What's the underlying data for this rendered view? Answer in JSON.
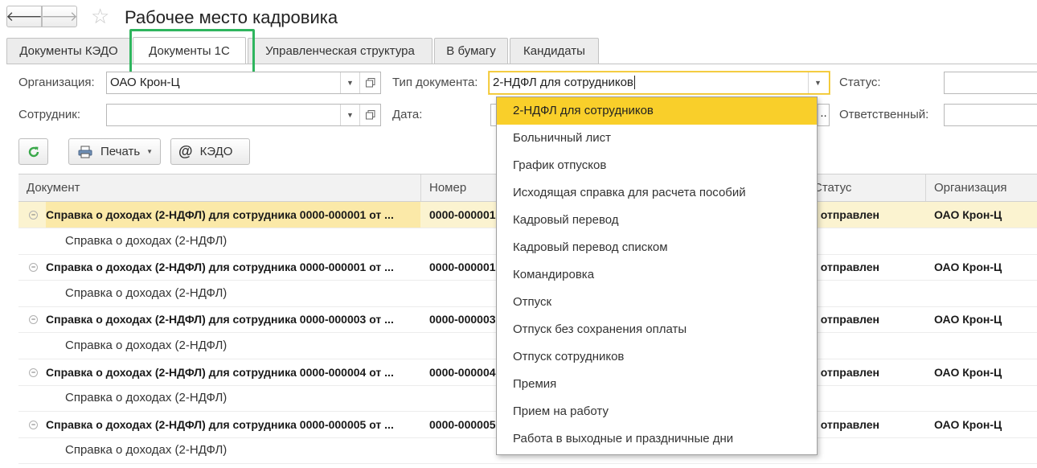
{
  "window": {
    "title": "Рабочее место кадровика",
    "back_glyph": "🡐",
    "forward_glyph": "🡒",
    "star_glyph": "☆"
  },
  "tabs": [
    {
      "label": "Документы КЭДО",
      "active": false
    },
    {
      "label": "Документы 1С",
      "active": true
    },
    {
      "label": "Управленческая структура",
      "active": false
    },
    {
      "label": "В бумагу",
      "active": false
    },
    {
      "label": "Кандидаты",
      "active": false
    }
  ],
  "filters": {
    "organization_label": "Организация:",
    "organization_value": "ОАО Крон-Ц",
    "employee_label": "Сотрудник:",
    "employee_value": "",
    "doc_type_label": "Тип документа:",
    "doc_type_value": "2-НДФЛ для сотрудников",
    "date_label": "Дата:",
    "status_label": "Статус:",
    "responsible_label": "Ответственный:"
  },
  "toolbar": {
    "refresh_icon": "refresh-icon",
    "print_label": "Печать",
    "kedo_label": "КЭДО"
  },
  "table": {
    "columns": [
      "Документ",
      "Номер",
      "Статус",
      "Организация"
    ],
    "rows": [
      {
        "document": "Справка о доходах (2-НДФЛ) для сотрудника 0000-000001 от ...",
        "number": "0000-000001",
        "status": "Не отправлен",
        "org": "ОАО Крон-Ц",
        "child": "Справка о доходах (2-НДФЛ)"
      },
      {
        "document": "Справка о доходах (2-НДФЛ) для сотрудника 0000-000001 от ...",
        "number": "0000-000001",
        "status": "Не отправлен",
        "org": "ОАО Крон-Ц",
        "child": "Справка о доходах (2-НДФЛ)"
      },
      {
        "document": "Справка о доходах (2-НДФЛ) для сотрудника 0000-000003 от ...",
        "number": "0000-000003",
        "status": "Не отправлен",
        "org": "ОАО Крон-Ц",
        "child": "Справка о доходах (2-НДФЛ)"
      },
      {
        "document": "Справка о доходах (2-НДФЛ) для сотрудника 0000-000004 от ...",
        "number": "0000-000004",
        "status": "Не отправлен",
        "org": "ОАО Крон-Ц",
        "child": "Справка о доходах (2-НДФЛ)"
      },
      {
        "document": "Справка о доходах (2-НДФЛ) для сотрудника 0000-000005 от ...",
        "number": "0000-000005",
        "status": "Не отправлен",
        "org": "ОАО Крон-Ц",
        "child": "Справка о доходах (2-НДФЛ)"
      }
    ]
  },
  "dropdown": {
    "items": [
      "2-НДФЛ для сотрудников",
      "Больничный лист",
      "График отпусков",
      "Исходящая справка для расчета пособий",
      "Кадровый перевод",
      "Кадровый перевод списком",
      "Командировка",
      "Отпуск",
      "Отпуск без сохранения оплаты",
      "Отпуск сотрудников",
      "Премия",
      "Прием на работу",
      "Работа в выходные и праздничные дни"
    ],
    "selected_index": 0
  },
  "colors": {
    "accent_yellow": "#f9cf2a",
    "highlight_green": "#2fb55e",
    "selected_row": "#fbe9a8",
    "refresh_green": "#3aa84a"
  }
}
